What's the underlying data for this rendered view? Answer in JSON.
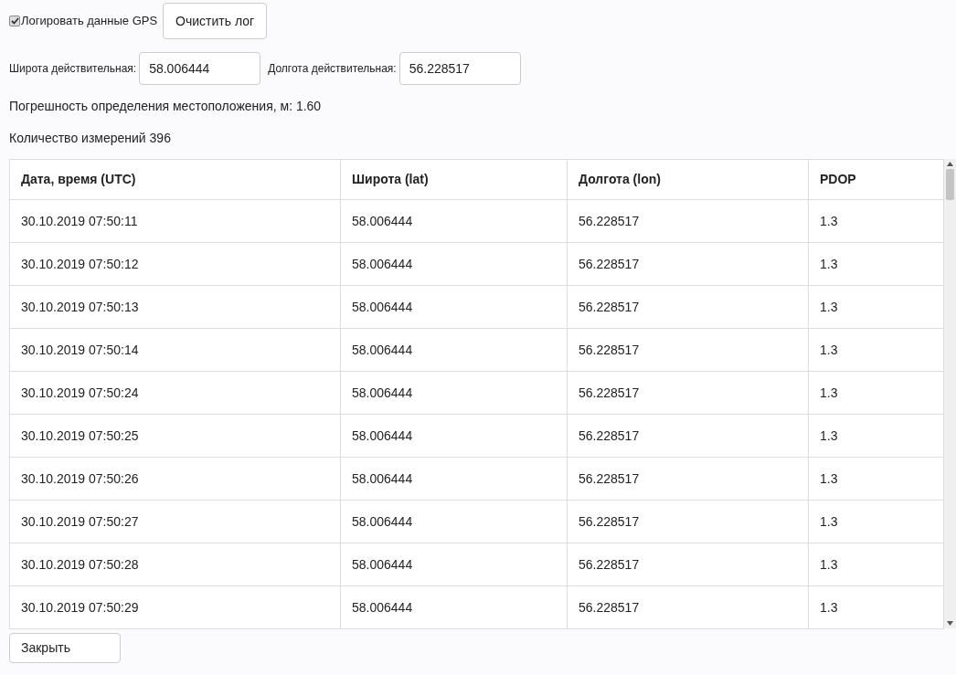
{
  "log_gps": {
    "label": "Логировать данные GPS",
    "checked": true
  },
  "clear_button": "Очистить лог",
  "fields": [
    {
      "label": "Широта действительная:",
      "value": "58.006444"
    },
    {
      "label": "Долгота действительная:",
      "value": "56.228517"
    }
  ],
  "accuracy": "Погрешность определения местоположения, м: 1.60",
  "count": "Количество измерений 396",
  "table": {
    "columns": [
      "Дата, время (UTC)",
      "Широта (lat)",
      "Долгота (lon)",
      "PDOP"
    ],
    "rows": [
      [
        "30.10.2019 07:50:11",
        "58.006444",
        "56.228517",
        "1.3"
      ],
      [
        "30.10.2019 07:50:12",
        "58.006444",
        "56.228517",
        "1.3"
      ],
      [
        "30.10.2019 07:50:13",
        "58.006444",
        "56.228517",
        "1.3"
      ],
      [
        "30.10.2019 07:50:14",
        "58.006444",
        "56.228517",
        "1.3"
      ],
      [
        "30.10.2019 07:50:24",
        "58.006444",
        "56.228517",
        "1.3"
      ],
      [
        "30.10.2019 07:50:25",
        "58.006444",
        "56.228517",
        "1.3"
      ],
      [
        "30.10.2019 07:50:26",
        "58.006444",
        "56.228517",
        "1.3"
      ],
      [
        "30.10.2019 07:50:27",
        "58.006444",
        "56.228517",
        "1.3"
      ],
      [
        "30.10.2019 07:50:28",
        "58.006444",
        "56.228517",
        "1.3"
      ],
      [
        "30.10.2019 07:50:29",
        "58.006444",
        "56.228517",
        "1.3"
      ]
    ]
  },
  "close_button": "Закрыть"
}
